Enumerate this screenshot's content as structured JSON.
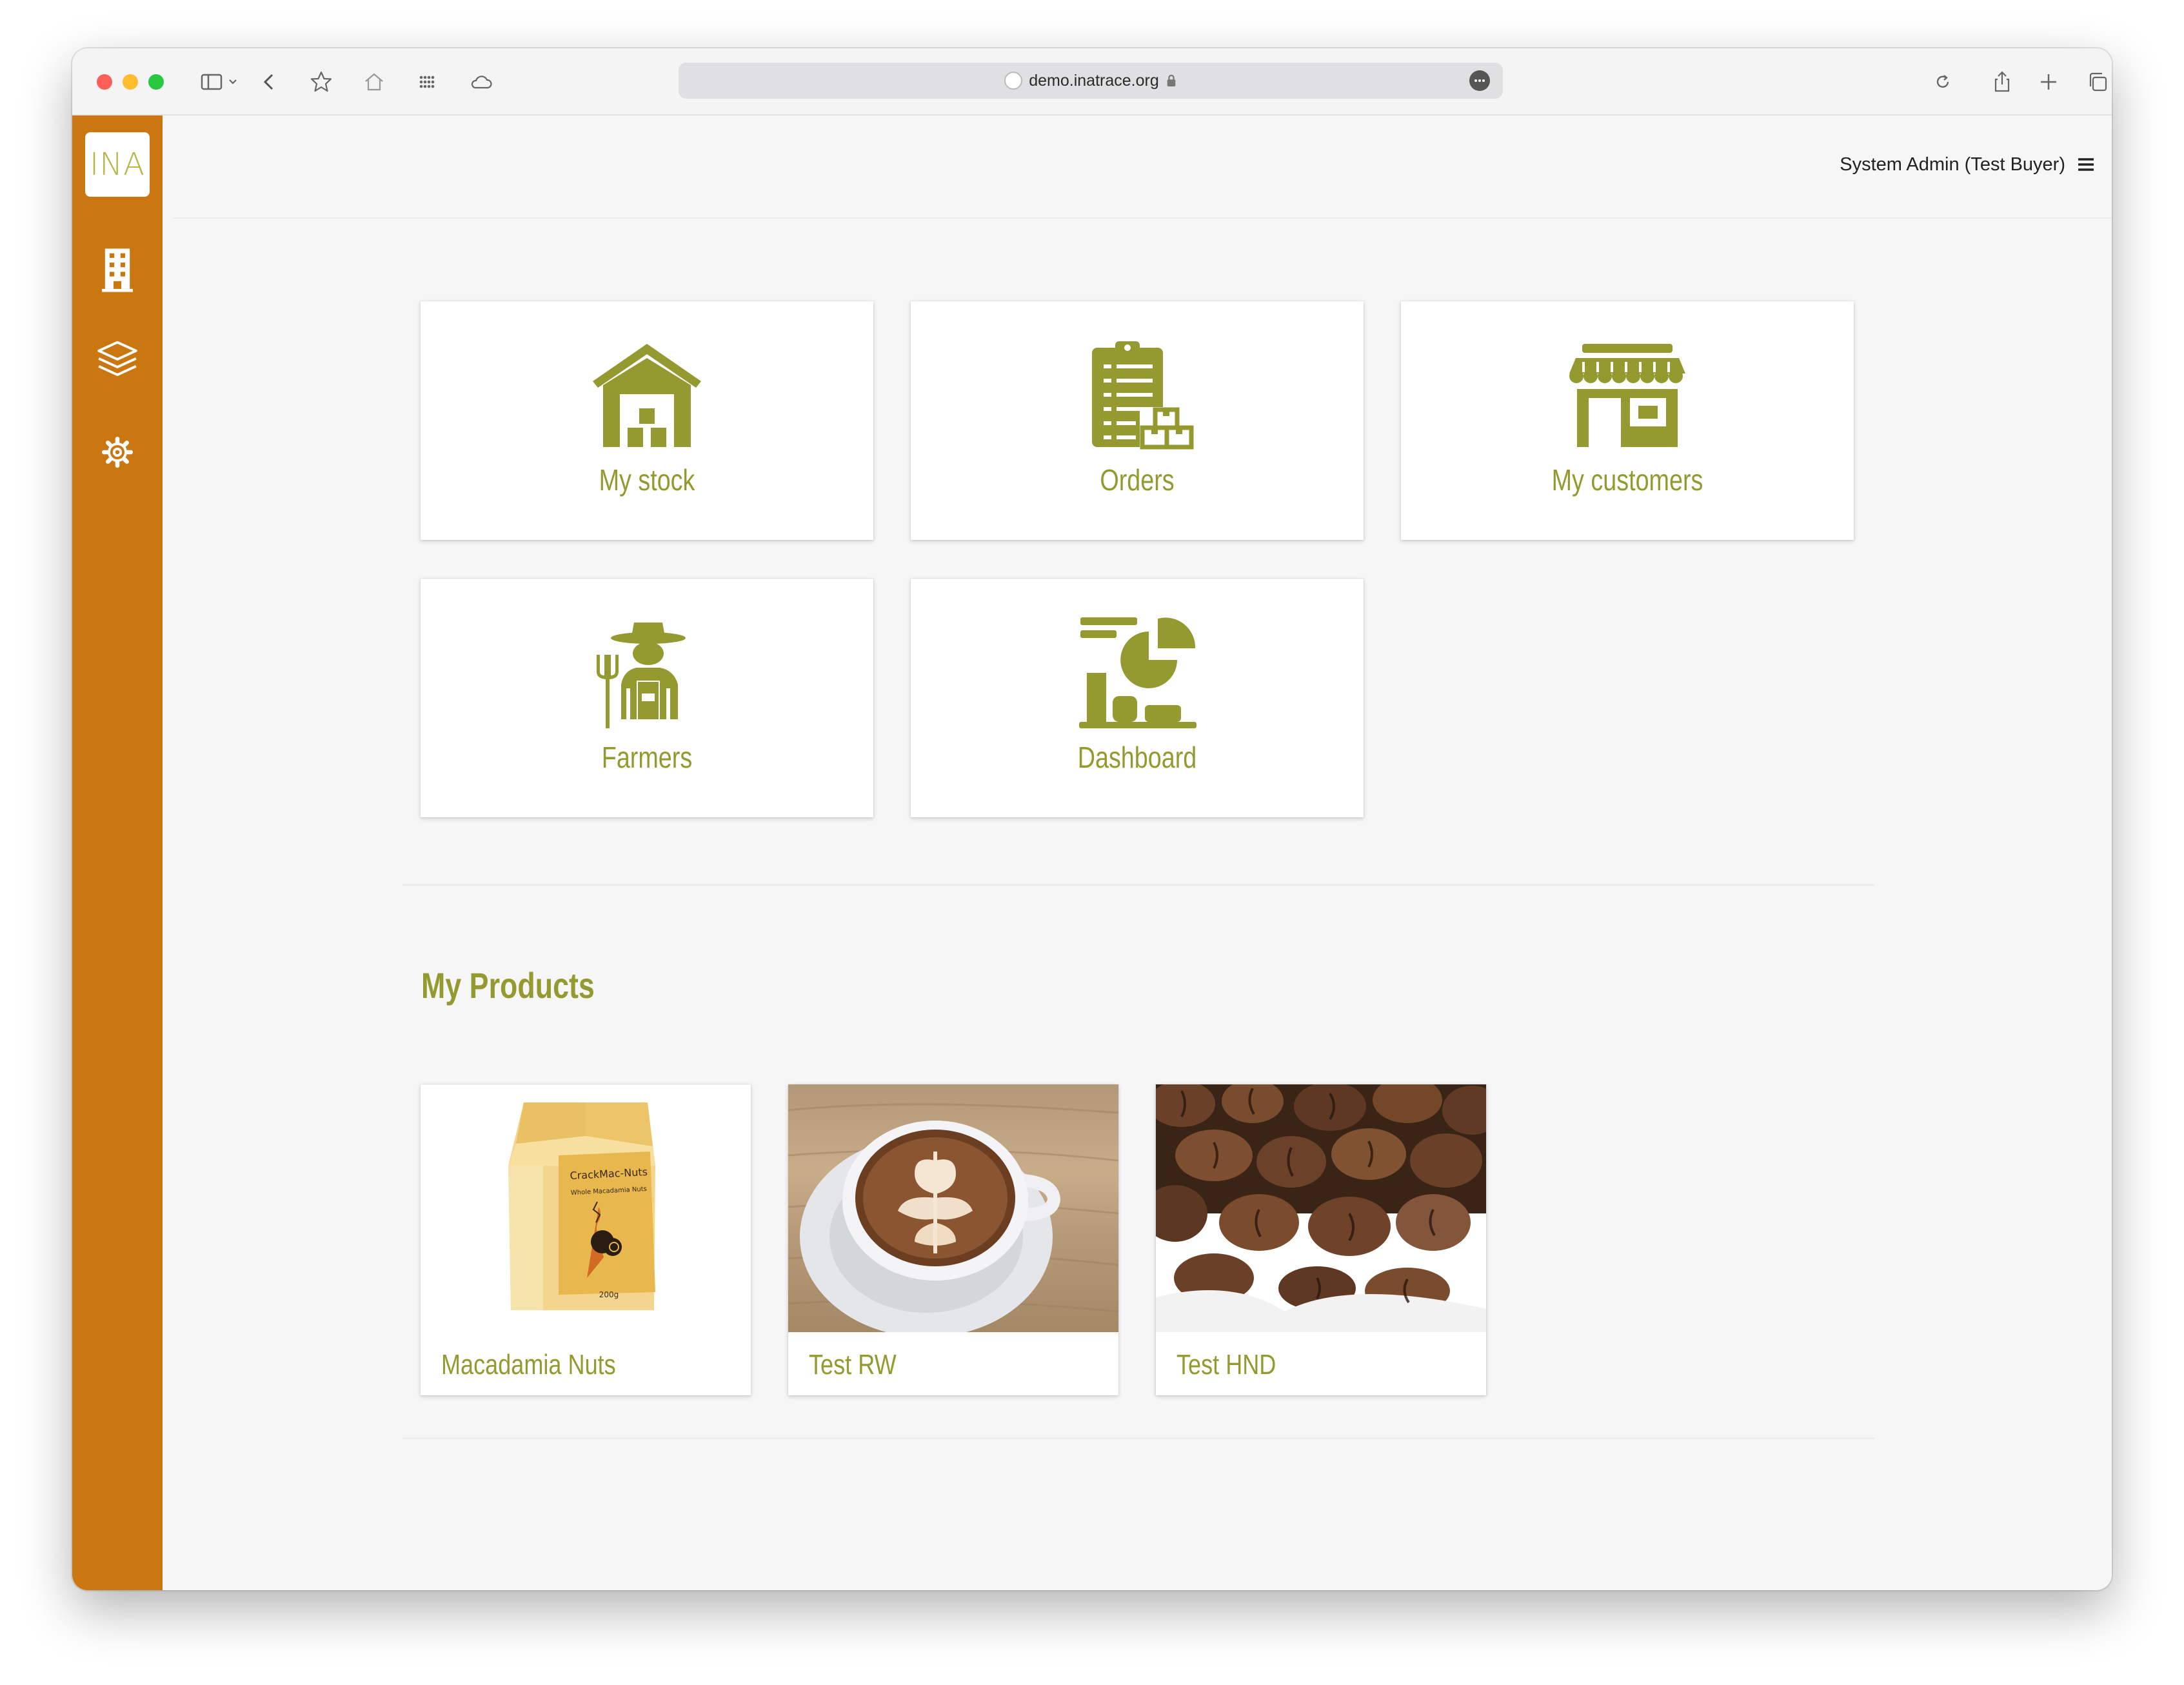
{
  "browser": {
    "url": "demo.inatrace.org"
  },
  "app": {
    "logo_text": "INA"
  },
  "header": {
    "user_name": "System Admin (Test Buyer)"
  },
  "tiles": [
    {
      "label": "My stock",
      "icon": "warehouse-icon"
    },
    {
      "label": "Orders",
      "icon": "clipboard-boxes-icon"
    },
    {
      "label": "My customers",
      "icon": "storefront-icon"
    },
    {
      "label": "Farmers",
      "icon": "farmer-icon"
    },
    {
      "label": "Dashboard",
      "icon": "chart-dashboard-icon"
    }
  ],
  "products_section": {
    "title": "My Products",
    "items": [
      {
        "name": "Macadamia Nuts",
        "package_brand": "CrackMac-Nuts",
        "package_subtitle": "Whole Macadamia Nuts",
        "package_weight": "200g"
      },
      {
        "name": "Test RW"
      },
      {
        "name": "Test HND"
      }
    ]
  },
  "colors": {
    "sidebar": "#cb7711",
    "accent": "#949a2f",
    "background": "#f6f6f6"
  }
}
